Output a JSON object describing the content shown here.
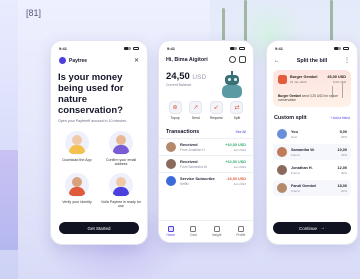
{
  "frame_label": "[81]",
  "status_time": "9:41",
  "phone1": {
    "brand": "Paytree",
    "headline": "Is your money being used for nature conservation?",
    "subtext": "Open your Paytreeff account in 10 minutes.",
    "features": [
      {
        "label": "Download the App",
        "icon": "person-download-illustration",
        "accent": "#f2c14e"
      },
      {
        "label": "Confirm your email address",
        "icon": "person-email-illustration",
        "accent": "#7a5bd6"
      },
      {
        "label": "Verify your Identity",
        "icon": "person-id-illustration",
        "accent": "#e05b3a"
      },
      {
        "label": "Voilà Paytree is ready for use",
        "icon": "person-ready-illustration",
        "accent": "#4c3fe0"
      }
    ],
    "cta": "Get Started"
  },
  "phone2": {
    "greeting": "Hi, Bima Aigitori",
    "balance_value": "24,50",
    "balance_currency": "USD",
    "balance_label": "Current Balance",
    "actions": [
      {
        "label": "Topup",
        "glyph": "⊕"
      },
      {
        "label": "Send",
        "glyph": "↗"
      },
      {
        "label": "Request",
        "glyph": "↙"
      },
      {
        "label": "Split",
        "glyph": "⇄"
      }
    ],
    "transactions_title": "Transactions",
    "see_all": "See All",
    "transactions": [
      {
        "name": "Received",
        "sub": "From Jonathan H.",
        "amount": "+10,00 USD",
        "date": "Jan 2023",
        "amount_color": "#2ea86b",
        "avatar_color": "#b58a6a"
      },
      {
        "name": "Received",
        "sub": "From Samantha W.",
        "amount": "+10,00 USD",
        "date": "Jan 2023",
        "amount_color": "#2ea86b",
        "avatar_color": "#8a6a5a"
      },
      {
        "name": "Service Subscribe",
        "sub": "Netflix",
        "amount": "-15,00 USD",
        "date": "Jan 2023",
        "amount_color": "#e05b3a",
        "avatar_color": "#3c6bd8"
      }
    ],
    "nav": [
      {
        "label": "Home",
        "active": true
      },
      {
        "label": "Card",
        "active": false
      },
      {
        "label": "Insight",
        "active": false
      },
      {
        "label": "Profile",
        "active": false
      }
    ]
  },
  "phone3": {
    "title": "Split the bill",
    "bill": {
      "name": "Burger Gembel",
      "date": "24 Jan 2023",
      "amount": "45,00 USD",
      "sub_amount": "5,00 USD",
      "note_bold": "Burger Gembel",
      "note_rest": " send 0,25 USD for nature conservation"
    },
    "custom_split_title": "Custom split",
    "add_friend": "+ Add a friend",
    "people": [
      {
        "name": "You",
        "role": "Host",
        "amount": "5,00",
        "percent": "20%",
        "avatar_color": "#6a8fd6"
      },
      {
        "name": "Samantha W.",
        "role": "Friend",
        "amount": "10,00",
        "percent": "40%",
        "avatar_color": "#c07a5a"
      },
      {
        "name": "Jonathan H.",
        "role": "Friend",
        "amount": "12,00",
        "percent": "40%",
        "avatar_color": "#8a6a5a"
      },
      {
        "name": "Fandi Gembel",
        "role": "Friend",
        "amount": "18,00",
        "percent": "20%",
        "avatar_color": "#b58a6a"
      }
    ],
    "cta": "Continue"
  }
}
